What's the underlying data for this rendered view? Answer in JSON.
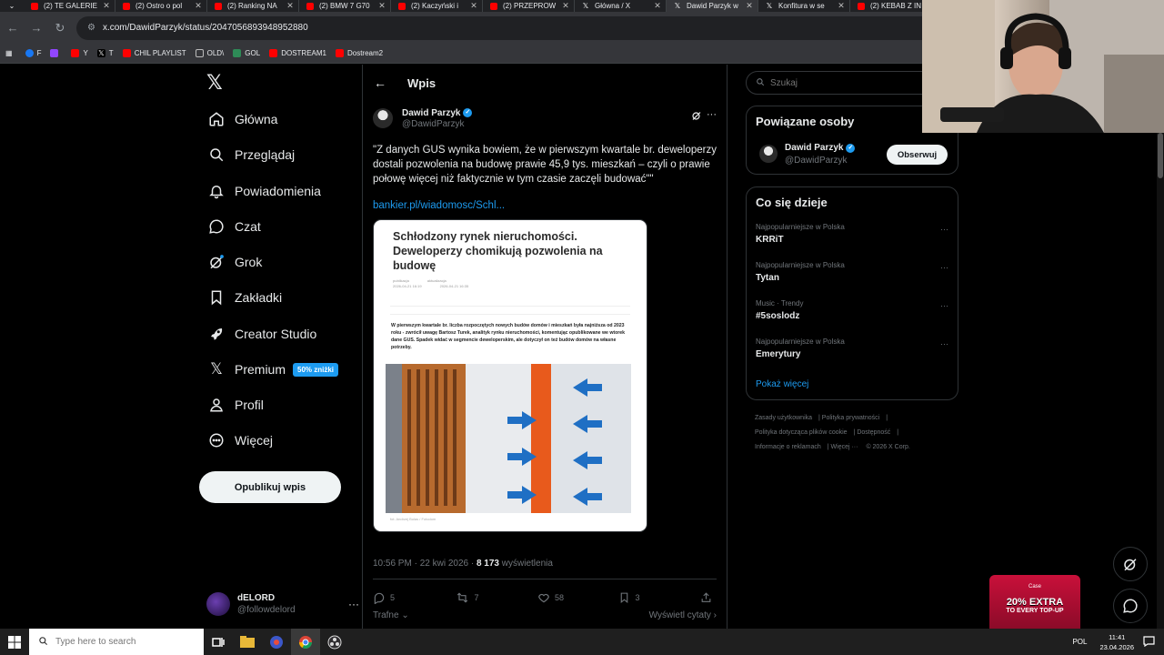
{
  "browser": {
    "tabs": [
      {
        "title": "(2) TE GALERIE",
        "icon": "youtube-icon",
        "active": false
      },
      {
        "title": "(2) Ostro o pol",
        "icon": "youtube-icon",
        "active": false
      },
      {
        "title": "(2) Ranking NA",
        "icon": "youtube-icon",
        "active": false
      },
      {
        "title": "(2) BMW 7 G70",
        "icon": "youtube-icon",
        "active": false
      },
      {
        "title": "(2) Kaczyński i",
        "icon": "youtube-icon",
        "active": false
      },
      {
        "title": "(2) PRZEPROW",
        "icon": "youtube-icon",
        "active": false
      },
      {
        "title": "Główna / X",
        "icon": "x-icon",
        "active": false
      },
      {
        "title": "Dawid Parzyk w",
        "icon": "x-icon",
        "active": true
      },
      {
        "title": "Konfitura w se",
        "icon": "x-icon",
        "active": false
      },
      {
        "title": "(2) KEBAB Z IN",
        "icon": "youtube-icon",
        "active": false
      }
    ],
    "url": "x.com/DawidParzyk/status/2047056893948952880",
    "bookmarks": [
      {
        "label": "F",
        "color": "#1877f2"
      },
      {
        "label": "",
        "color": "#9146ff"
      },
      {
        "label": "Y",
        "color": "#ff0000"
      },
      {
        "label": "T",
        "color": "#000000"
      },
      {
        "label": "CHIL PLAYLIST",
        "color": "#ff0000"
      },
      {
        "label": "OLD\\",
        "color": "#8a8a8a"
      },
      {
        "label": "GOL",
        "color": "#2e8b57"
      },
      {
        "label": "DOSTREAM1",
        "color": "#ff0000"
      },
      {
        "label": "Dostream2",
        "color": "#ff0000"
      }
    ]
  },
  "nav": {
    "items": [
      {
        "label": "Główna",
        "icon": "home-icon"
      },
      {
        "label": "Przeglądaj",
        "icon": "search-icon"
      },
      {
        "label": "Powiadomienia",
        "icon": "bell-icon"
      },
      {
        "label": "Czat",
        "icon": "chat-icon"
      },
      {
        "label": "Grok",
        "icon": "grok-icon"
      },
      {
        "label": "Zakładki",
        "icon": "bookmark-icon"
      },
      {
        "label": "Creator Studio",
        "icon": "rocket-icon"
      },
      {
        "label": "Premium",
        "icon": "x-logo-icon"
      },
      {
        "label": "Profil",
        "icon": "profile-icon"
      },
      {
        "label": "Więcej",
        "icon": "more-circle-icon"
      }
    ],
    "premium_badge": "50% zniżki",
    "post_button": "Opublikuj wpis",
    "account": {
      "name": "dELORD",
      "handle": "@followdelord"
    }
  },
  "post": {
    "header_title": "Wpis",
    "author_name": "Dawid Parzyk",
    "author_handle": "@DawidParzyk",
    "text": "\"Z danych GUS wynika bowiem, że w pierwszym kwartale br. deweloperzy dostali pozwolenia na budowę prawie 45,9 tys. mieszkań – czyli o prawie połowę więcej niż faktycznie w tym czasie zaczęli budować\"\"",
    "link": "bankier.pl/wiadomosc/Schl...",
    "article": {
      "headline": "Schłodzony rynek nieruchomości. Deweloperzy chomikują pozwolenia na budowę",
      "published_label": "publikacja",
      "published": "2026-04-21 16:19",
      "updated_label": "aktualizacja",
      "updated": "2026-04-21 16:35",
      "lead": "W pierwszym kwartale br. liczba rozpoczętych nowych budów domów i mieszkań była najniższa od 2023 roku - zwrócił uwagę Bartosz Turek, analityk rynku nieruchomości, komentując opublikowane we wtorek dane GUS. Spadek widać w segmencie deweloperskim, ale dotyczył on też budów domów na własne potrzeby.",
      "caption": "fot. Andrzej Bulas / Fotodom"
    },
    "time": "10:56 PM",
    "date": "22 kwi 2026",
    "views": "8 173",
    "views_label": "wyświetlenia",
    "stats": {
      "replies": "5",
      "reposts": "7",
      "likes": "58",
      "bookmarks": "3"
    },
    "filter_label": "Trafne",
    "quotes_label": "Wyświetl cytaty"
  },
  "sidebar": {
    "search_placeholder": "Szukaj",
    "related_title": "Powiązane osoby",
    "related_person": {
      "name": "Dawid Parzyk",
      "handle": "@DawidParzyk",
      "follow_label": "Obserwuj"
    },
    "trends_title": "Co się dzieje",
    "trends": [
      {
        "context": "Najpopularniejsze w Polska",
        "name": "KRRiT"
      },
      {
        "context": "Najpopularniejsze w Polska",
        "name": "Tytan"
      },
      {
        "context": "Music · Trendy",
        "name": "#5soslodz"
      },
      {
        "context": "Najpopularniejsze w Polska",
        "name": "Emerytury"
      }
    ],
    "show_more": "Pokaż więcej",
    "footer_links": [
      "Zasady użytkownika",
      "Polityka prywatności",
      "Polityka dotycząca plików cookie",
      "Dostępność",
      "Informacje o reklamach",
      "Więcej ···",
      "© 2026 X Corp."
    ]
  },
  "ad": {
    "logo": "Case",
    "headline": "20% EXTRA",
    "subline": "TO EVERY TOP-UP"
  },
  "taskbar": {
    "search_placeholder": "Type here to search",
    "language": "POL",
    "time": "11:41",
    "date": "23.04.2026"
  },
  "colors": {
    "accent": "#1d9bf0",
    "background": "#000000",
    "text": "#e7e9ea",
    "muted": "#71767b",
    "border": "#2f3336"
  }
}
